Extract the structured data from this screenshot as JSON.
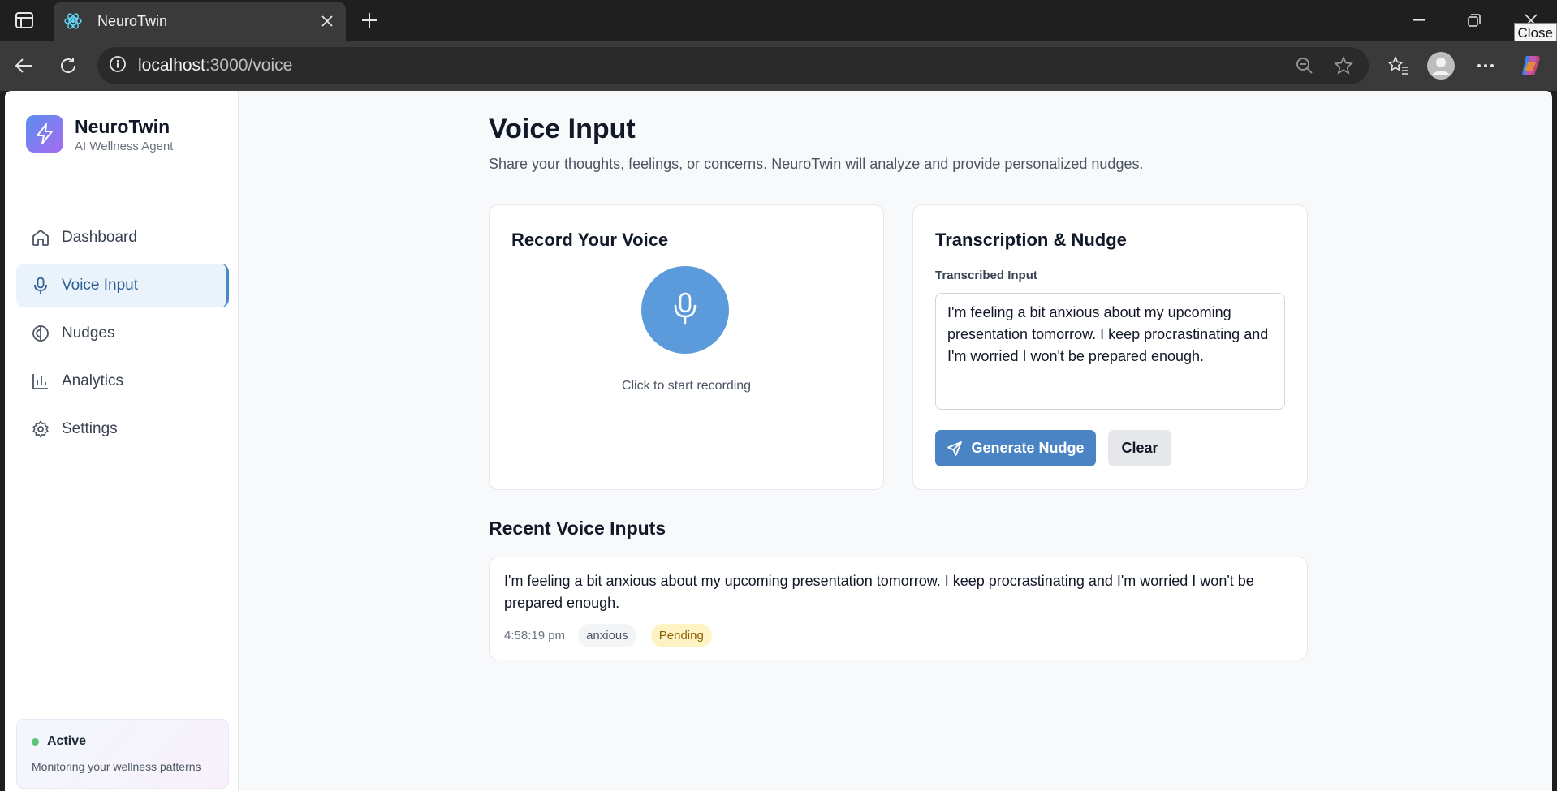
{
  "browser": {
    "tab_title": "NeuroTwin",
    "url_host": "localhost",
    "url_path": ":3000/voice",
    "tooltip": "Close"
  },
  "sidebar": {
    "brand_name": "NeuroTwin",
    "brand_subtitle": "AI Wellness Agent",
    "items": [
      {
        "label": "Dashboard",
        "icon": "home-icon",
        "active": false
      },
      {
        "label": "Voice Input",
        "icon": "mic-icon",
        "active": true
      },
      {
        "label": "Nudges",
        "icon": "brain-icon",
        "active": false
      },
      {
        "label": "Analytics",
        "icon": "bar-chart-icon",
        "active": false
      },
      {
        "label": "Settings",
        "icon": "gear-icon",
        "active": false
      }
    ],
    "status": {
      "title": "Active",
      "description": "Monitoring your wellness patterns",
      "color": "#5ec47a"
    }
  },
  "main": {
    "title": "Voice Input",
    "description": "Share your thoughts, feelings, or concerns. NeuroTwin will analyze and provide personalized nudges.",
    "record_card": {
      "title": "Record Your Voice",
      "hint": "Click to start recording"
    },
    "transcription_card": {
      "title": "Transcription & Nudge",
      "field_label": "Transcribed Input",
      "field_value": "I'm feeling a bit anxious about my upcoming presentation tomorrow. I keep procrastinating and I'm worried I won't be prepared enough.",
      "generate_label": "Generate Nudge",
      "clear_label": "Clear"
    },
    "recent": {
      "title": "Recent Voice Inputs",
      "items": [
        {
          "text": "I'm feeling a bit anxious about my upcoming presentation tomorrow. I keep procrastinating and I'm worried I won't be prepared enough.",
          "time": "4:58:19 pm",
          "mood": "anxious",
          "status": "Pending"
        }
      ]
    }
  },
  "colors": {
    "accent": "#4a84c4",
    "mic": "#5b9bdc",
    "pending_bg": "#fdf3c4"
  }
}
